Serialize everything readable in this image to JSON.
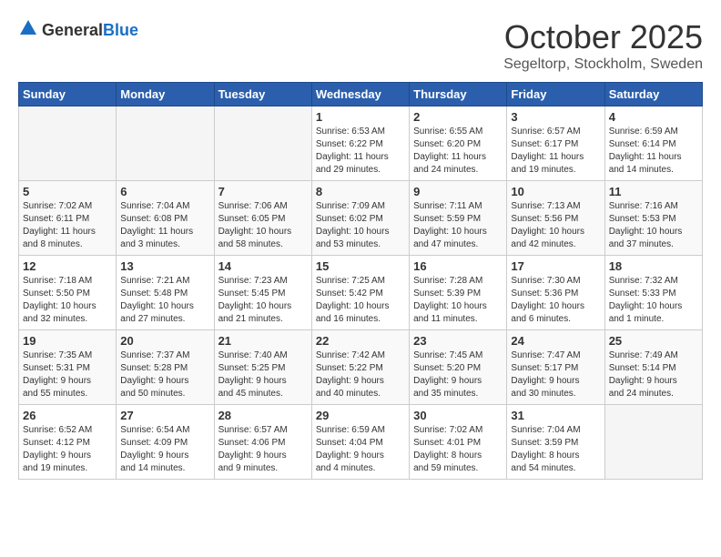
{
  "logo": {
    "general": "General",
    "blue": "Blue"
  },
  "header": {
    "month": "October 2025",
    "location": "Segeltorp, Stockholm, Sweden"
  },
  "weekdays": [
    "Sunday",
    "Monday",
    "Tuesday",
    "Wednesday",
    "Thursday",
    "Friday",
    "Saturday"
  ],
  "weeks": [
    [
      {
        "day": "",
        "info": ""
      },
      {
        "day": "",
        "info": ""
      },
      {
        "day": "",
        "info": ""
      },
      {
        "day": "1",
        "info": "Sunrise: 6:53 AM\nSunset: 6:22 PM\nDaylight: 11 hours\nand 29 minutes."
      },
      {
        "day": "2",
        "info": "Sunrise: 6:55 AM\nSunset: 6:20 PM\nDaylight: 11 hours\nand 24 minutes."
      },
      {
        "day": "3",
        "info": "Sunrise: 6:57 AM\nSunset: 6:17 PM\nDaylight: 11 hours\nand 19 minutes."
      },
      {
        "day": "4",
        "info": "Sunrise: 6:59 AM\nSunset: 6:14 PM\nDaylight: 11 hours\nand 14 minutes."
      }
    ],
    [
      {
        "day": "5",
        "info": "Sunrise: 7:02 AM\nSunset: 6:11 PM\nDaylight: 11 hours\nand 8 minutes."
      },
      {
        "day": "6",
        "info": "Sunrise: 7:04 AM\nSunset: 6:08 PM\nDaylight: 11 hours\nand 3 minutes."
      },
      {
        "day": "7",
        "info": "Sunrise: 7:06 AM\nSunset: 6:05 PM\nDaylight: 10 hours\nand 58 minutes."
      },
      {
        "day": "8",
        "info": "Sunrise: 7:09 AM\nSunset: 6:02 PM\nDaylight: 10 hours\nand 53 minutes."
      },
      {
        "day": "9",
        "info": "Sunrise: 7:11 AM\nSunset: 5:59 PM\nDaylight: 10 hours\nand 47 minutes."
      },
      {
        "day": "10",
        "info": "Sunrise: 7:13 AM\nSunset: 5:56 PM\nDaylight: 10 hours\nand 42 minutes."
      },
      {
        "day": "11",
        "info": "Sunrise: 7:16 AM\nSunset: 5:53 PM\nDaylight: 10 hours\nand 37 minutes."
      }
    ],
    [
      {
        "day": "12",
        "info": "Sunrise: 7:18 AM\nSunset: 5:50 PM\nDaylight: 10 hours\nand 32 minutes."
      },
      {
        "day": "13",
        "info": "Sunrise: 7:21 AM\nSunset: 5:48 PM\nDaylight: 10 hours\nand 27 minutes."
      },
      {
        "day": "14",
        "info": "Sunrise: 7:23 AM\nSunset: 5:45 PM\nDaylight: 10 hours\nand 21 minutes."
      },
      {
        "day": "15",
        "info": "Sunrise: 7:25 AM\nSunset: 5:42 PM\nDaylight: 10 hours\nand 16 minutes."
      },
      {
        "day": "16",
        "info": "Sunrise: 7:28 AM\nSunset: 5:39 PM\nDaylight: 10 hours\nand 11 minutes."
      },
      {
        "day": "17",
        "info": "Sunrise: 7:30 AM\nSunset: 5:36 PM\nDaylight: 10 hours\nand 6 minutes."
      },
      {
        "day": "18",
        "info": "Sunrise: 7:32 AM\nSunset: 5:33 PM\nDaylight: 10 hours\nand 1 minute."
      }
    ],
    [
      {
        "day": "19",
        "info": "Sunrise: 7:35 AM\nSunset: 5:31 PM\nDaylight: 9 hours\nand 55 minutes."
      },
      {
        "day": "20",
        "info": "Sunrise: 7:37 AM\nSunset: 5:28 PM\nDaylight: 9 hours\nand 50 minutes."
      },
      {
        "day": "21",
        "info": "Sunrise: 7:40 AM\nSunset: 5:25 PM\nDaylight: 9 hours\nand 45 minutes."
      },
      {
        "day": "22",
        "info": "Sunrise: 7:42 AM\nSunset: 5:22 PM\nDaylight: 9 hours\nand 40 minutes."
      },
      {
        "day": "23",
        "info": "Sunrise: 7:45 AM\nSunset: 5:20 PM\nDaylight: 9 hours\nand 35 minutes."
      },
      {
        "day": "24",
        "info": "Sunrise: 7:47 AM\nSunset: 5:17 PM\nDaylight: 9 hours\nand 30 minutes."
      },
      {
        "day": "25",
        "info": "Sunrise: 7:49 AM\nSunset: 5:14 PM\nDaylight: 9 hours\nand 24 minutes."
      }
    ],
    [
      {
        "day": "26",
        "info": "Sunrise: 6:52 AM\nSunset: 4:12 PM\nDaylight: 9 hours\nand 19 minutes."
      },
      {
        "day": "27",
        "info": "Sunrise: 6:54 AM\nSunset: 4:09 PM\nDaylight: 9 hours\nand 14 minutes."
      },
      {
        "day": "28",
        "info": "Sunrise: 6:57 AM\nSunset: 4:06 PM\nDaylight: 9 hours\nand 9 minutes."
      },
      {
        "day": "29",
        "info": "Sunrise: 6:59 AM\nSunset: 4:04 PM\nDaylight: 9 hours\nand 4 minutes."
      },
      {
        "day": "30",
        "info": "Sunrise: 7:02 AM\nSunset: 4:01 PM\nDaylight: 8 hours\nand 59 minutes."
      },
      {
        "day": "31",
        "info": "Sunrise: 7:04 AM\nSunset: 3:59 PM\nDaylight: 8 hours\nand 54 minutes."
      },
      {
        "day": "",
        "info": ""
      }
    ]
  ]
}
